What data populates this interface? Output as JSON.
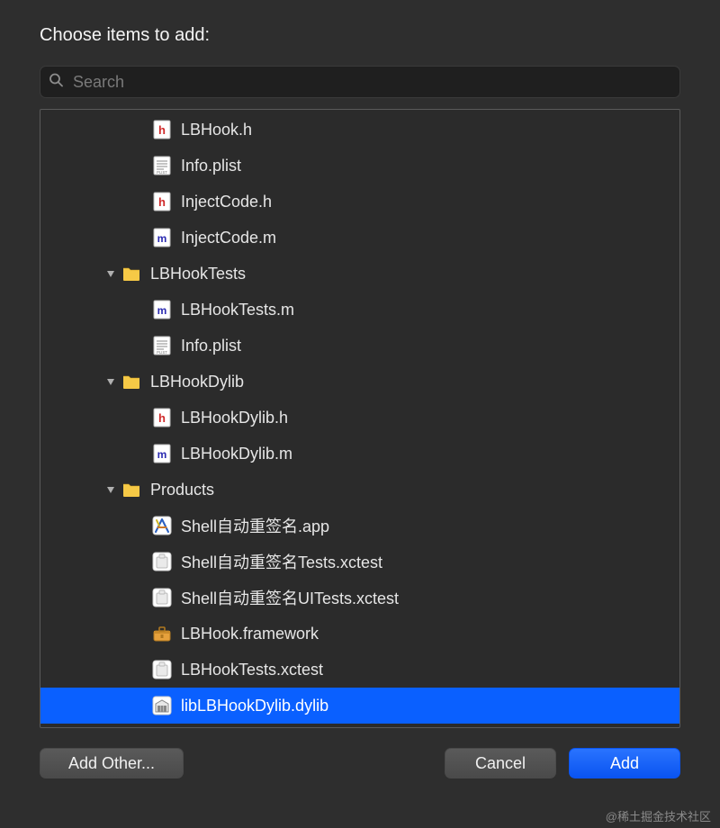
{
  "prompt": "Choose items to add:",
  "search": {
    "placeholder": "Search"
  },
  "tree": [
    {
      "indent": 2,
      "kind": "h",
      "label": "LBHook.h",
      "chevron": false,
      "selected": false
    },
    {
      "indent": 2,
      "kind": "plist",
      "label": "Info.plist",
      "chevron": false,
      "selected": false
    },
    {
      "indent": 2,
      "kind": "h",
      "label": "InjectCode.h",
      "chevron": false,
      "selected": false
    },
    {
      "indent": 2,
      "kind": "m",
      "label": "InjectCode.m",
      "chevron": false,
      "selected": false
    },
    {
      "indent": 1,
      "kind": "folder",
      "label": "LBHookTests",
      "chevron": true,
      "selected": false
    },
    {
      "indent": 2,
      "kind": "m",
      "label": "LBHookTests.m",
      "chevron": false,
      "selected": false
    },
    {
      "indent": 2,
      "kind": "plist",
      "label": "Info.plist",
      "chevron": false,
      "selected": false
    },
    {
      "indent": 1,
      "kind": "folder",
      "label": "LBHookDylib",
      "chevron": true,
      "selected": false
    },
    {
      "indent": 2,
      "kind": "h",
      "label": "LBHookDylib.h",
      "chevron": false,
      "selected": false
    },
    {
      "indent": 2,
      "kind": "m",
      "label": "LBHookDylib.m",
      "chevron": false,
      "selected": false
    },
    {
      "indent": 1,
      "kind": "folder",
      "label": "Products",
      "chevron": true,
      "selected": false
    },
    {
      "indent": 2,
      "kind": "app",
      "label": "Shell自动重签名.app",
      "chevron": false,
      "selected": false
    },
    {
      "indent": 2,
      "kind": "xctest",
      "label": "Shell自动重签名Tests.xctest",
      "chevron": false,
      "selected": false
    },
    {
      "indent": 2,
      "kind": "xctest",
      "label": "Shell自动重签名UITests.xctest",
      "chevron": false,
      "selected": false
    },
    {
      "indent": 2,
      "kind": "framework",
      "label": "LBHook.framework",
      "chevron": false,
      "selected": false
    },
    {
      "indent": 2,
      "kind": "xctest",
      "label": "LBHookTests.xctest",
      "chevron": false,
      "selected": false
    },
    {
      "indent": 2,
      "kind": "dylib",
      "label": "libLBHookDylib.dylib",
      "chevron": false,
      "selected": true
    }
  ],
  "buttons": {
    "add_other": "Add Other...",
    "cancel": "Cancel",
    "add": "Add"
  },
  "watermark": "@稀土掘金技术社区"
}
